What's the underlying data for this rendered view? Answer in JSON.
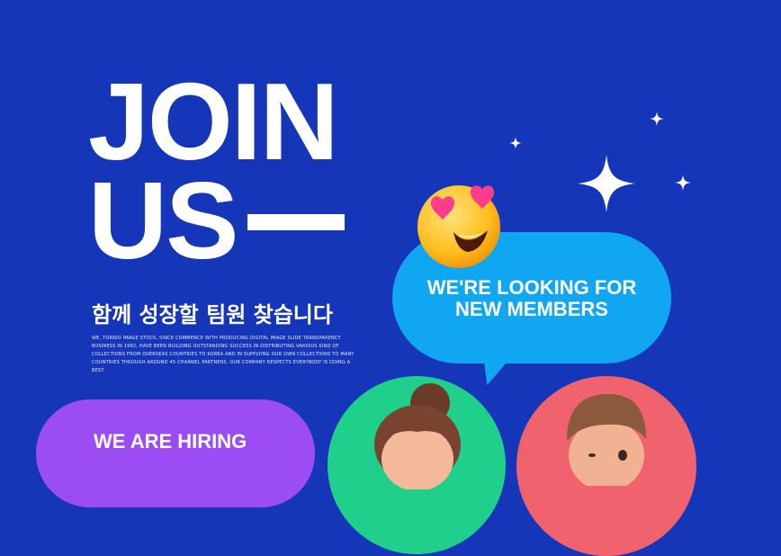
{
  "headline": {
    "line1": "JOIN",
    "line2": "US"
  },
  "subtitle": "함께 성장할 팀원 찾습니다",
  "body_copy": "WE, TORNIO IMAGE STOCK, SINCE COMMENCE WITH PRODUCING DIGITAL IMAGE SLIDE TRANSPARENCY BUSINESS IN 1992, HAVE BEEN BUILDING OUTSTANDING SUCCESS IN DISTRIBUTING VARIOUS KIND OF COLLECTIONS FROM OVERSEAS COUNTRIES TO KOREA AND IN SUPPLYING OUR OWN COLLECTIONS TO MANY COUNTRIES THROUGH AROUND 45 CHANNEL PARTNERS. OUR COMPANY RESPECTS EVERYBODY IS DOING A BEST.",
  "speech_bubble": {
    "line1": "WE'RE LOOKING FOR",
    "line2": "NEW MEMBERS"
  },
  "hiring_bubble": {
    "label": "WE ARE HIRING"
  },
  "colors": {
    "background": "#1536b8",
    "bubble_blue": "#10a6f2",
    "bubble_purple": "#9b4cf2",
    "circle_green": "#1fcf8a",
    "circle_pink": "#f0626e"
  },
  "icons": [
    "heart-eyes-emoji-icon",
    "sparkle-icon",
    "woman-avatar",
    "man-avatar"
  ]
}
